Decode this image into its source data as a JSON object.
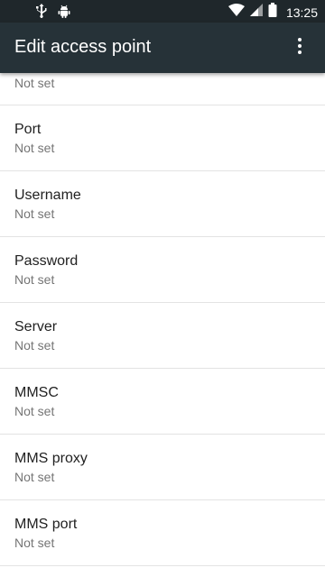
{
  "status_bar": {
    "time": "13:25",
    "icons": [
      "usb-icon",
      "android-debug-icon",
      "wifi-icon",
      "cell-signal-icon",
      "battery-icon"
    ]
  },
  "app_bar": {
    "title": "Edit access point",
    "overflow_icon": "more-vert-icon"
  },
  "partial_item": {
    "summary": "Not set"
  },
  "items": [
    {
      "title": "Port",
      "summary": "Not set"
    },
    {
      "title": "Username",
      "summary": "Not set"
    },
    {
      "title": "Password",
      "summary": "Not set"
    },
    {
      "title": "Server",
      "summary": "Not set"
    },
    {
      "title": "MMSC",
      "summary": "Not set"
    },
    {
      "title": "MMS proxy",
      "summary": "Not set"
    },
    {
      "title": "MMS port",
      "summary": "Not set"
    }
  ],
  "colors": {
    "status_bar": "#1f272b",
    "app_bar": "#263238",
    "title_text": "#212121",
    "summary_text": "#757575"
  }
}
